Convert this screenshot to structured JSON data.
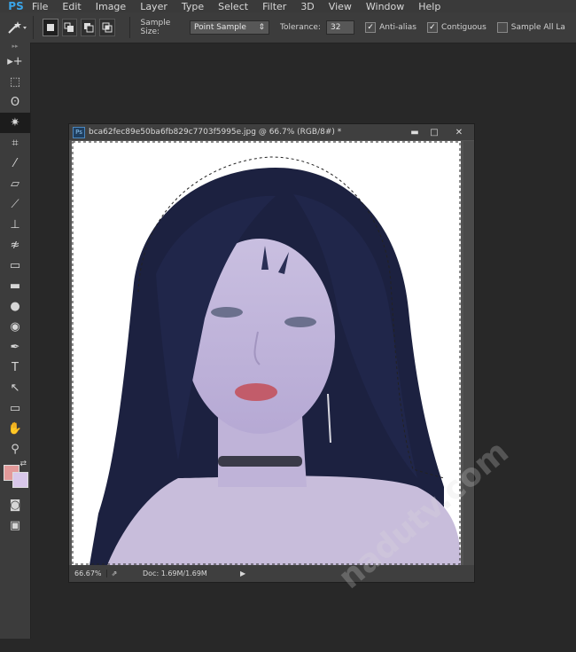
{
  "app": {
    "logo": "PS"
  },
  "menu": [
    "File",
    "Edit",
    "Image",
    "Layer",
    "Type",
    "Select",
    "Filter",
    "3D",
    "View",
    "Window",
    "Help"
  ],
  "options": {
    "sample_size_label": "Sample Size:",
    "sample_size_value": "Point Sample",
    "tolerance_label": "Tolerance:",
    "tolerance_value": "32",
    "antialias_label": "Anti-alias",
    "contiguous_label": "Contiguous",
    "sample_all_label": "Sample All La"
  },
  "toolbar": {
    "grip": "▸▸",
    "tools": [
      {
        "name": "move-tool",
        "icon": "move-icon",
        "glyph": "▸+"
      },
      {
        "name": "marquee-tool",
        "icon": "marquee-icon",
        "glyph": "⬚"
      },
      {
        "name": "lasso-tool",
        "icon": "lasso-icon",
        "glyph": "ʘ"
      },
      {
        "name": "magic-wand-tool",
        "icon": "magic-wand-icon",
        "glyph": "✷"
      },
      {
        "name": "crop-tool",
        "icon": "crop-icon",
        "glyph": "⌗"
      },
      {
        "name": "eyedropper-tool",
        "icon": "eyedropper-icon",
        "glyph": "⁄"
      },
      {
        "name": "healing-brush-tool",
        "icon": "bandage-icon",
        "glyph": "▱"
      },
      {
        "name": "brush-tool",
        "icon": "brush-icon",
        "glyph": "⟋"
      },
      {
        "name": "clone-stamp-tool",
        "icon": "stamp-icon",
        "glyph": "⊥"
      },
      {
        "name": "history-brush-tool",
        "icon": "history-brush-icon",
        "glyph": "≉"
      },
      {
        "name": "eraser-tool",
        "icon": "eraser-icon",
        "glyph": "▭"
      },
      {
        "name": "gradient-tool",
        "icon": "gradient-icon",
        "glyph": "▬"
      },
      {
        "name": "blur-tool",
        "icon": "drop-icon",
        "glyph": "●"
      },
      {
        "name": "dodge-tool",
        "icon": "dodge-icon",
        "glyph": "◉"
      },
      {
        "name": "pen-tool",
        "icon": "pen-icon",
        "glyph": "✒"
      },
      {
        "name": "type-tool",
        "icon": "type-icon",
        "glyph": "T"
      },
      {
        "name": "path-selection-tool",
        "icon": "arrow-icon",
        "glyph": "↖"
      },
      {
        "name": "shape-tool",
        "icon": "rectangle-icon",
        "glyph": "▭"
      },
      {
        "name": "hand-tool",
        "icon": "hand-icon",
        "glyph": "✋"
      },
      {
        "name": "zoom-tool",
        "icon": "magnifier-icon",
        "glyph": "⚲"
      }
    ],
    "swap_glyph": "⇄",
    "quick_mask_glyph": "◙",
    "screen_mode_glyph": "▣",
    "foreground_color": "#e39a9a",
    "background_color": "#d9c8ea"
  },
  "document": {
    "badge": "Ps",
    "title": "bca62fec89e50ba6fb829c7703f5995e.jpg @ 66.7% (RGB/8#) *",
    "min_glyph": "▬",
    "max_glyph": "□",
    "close_glyph": "✕",
    "zoom": "66.67%",
    "export_glyph": "⇗",
    "doc_size": "Doc: 1.69M/1.69M",
    "arrow_glyph": "▶"
  },
  "watermark": "nadutv.com"
}
